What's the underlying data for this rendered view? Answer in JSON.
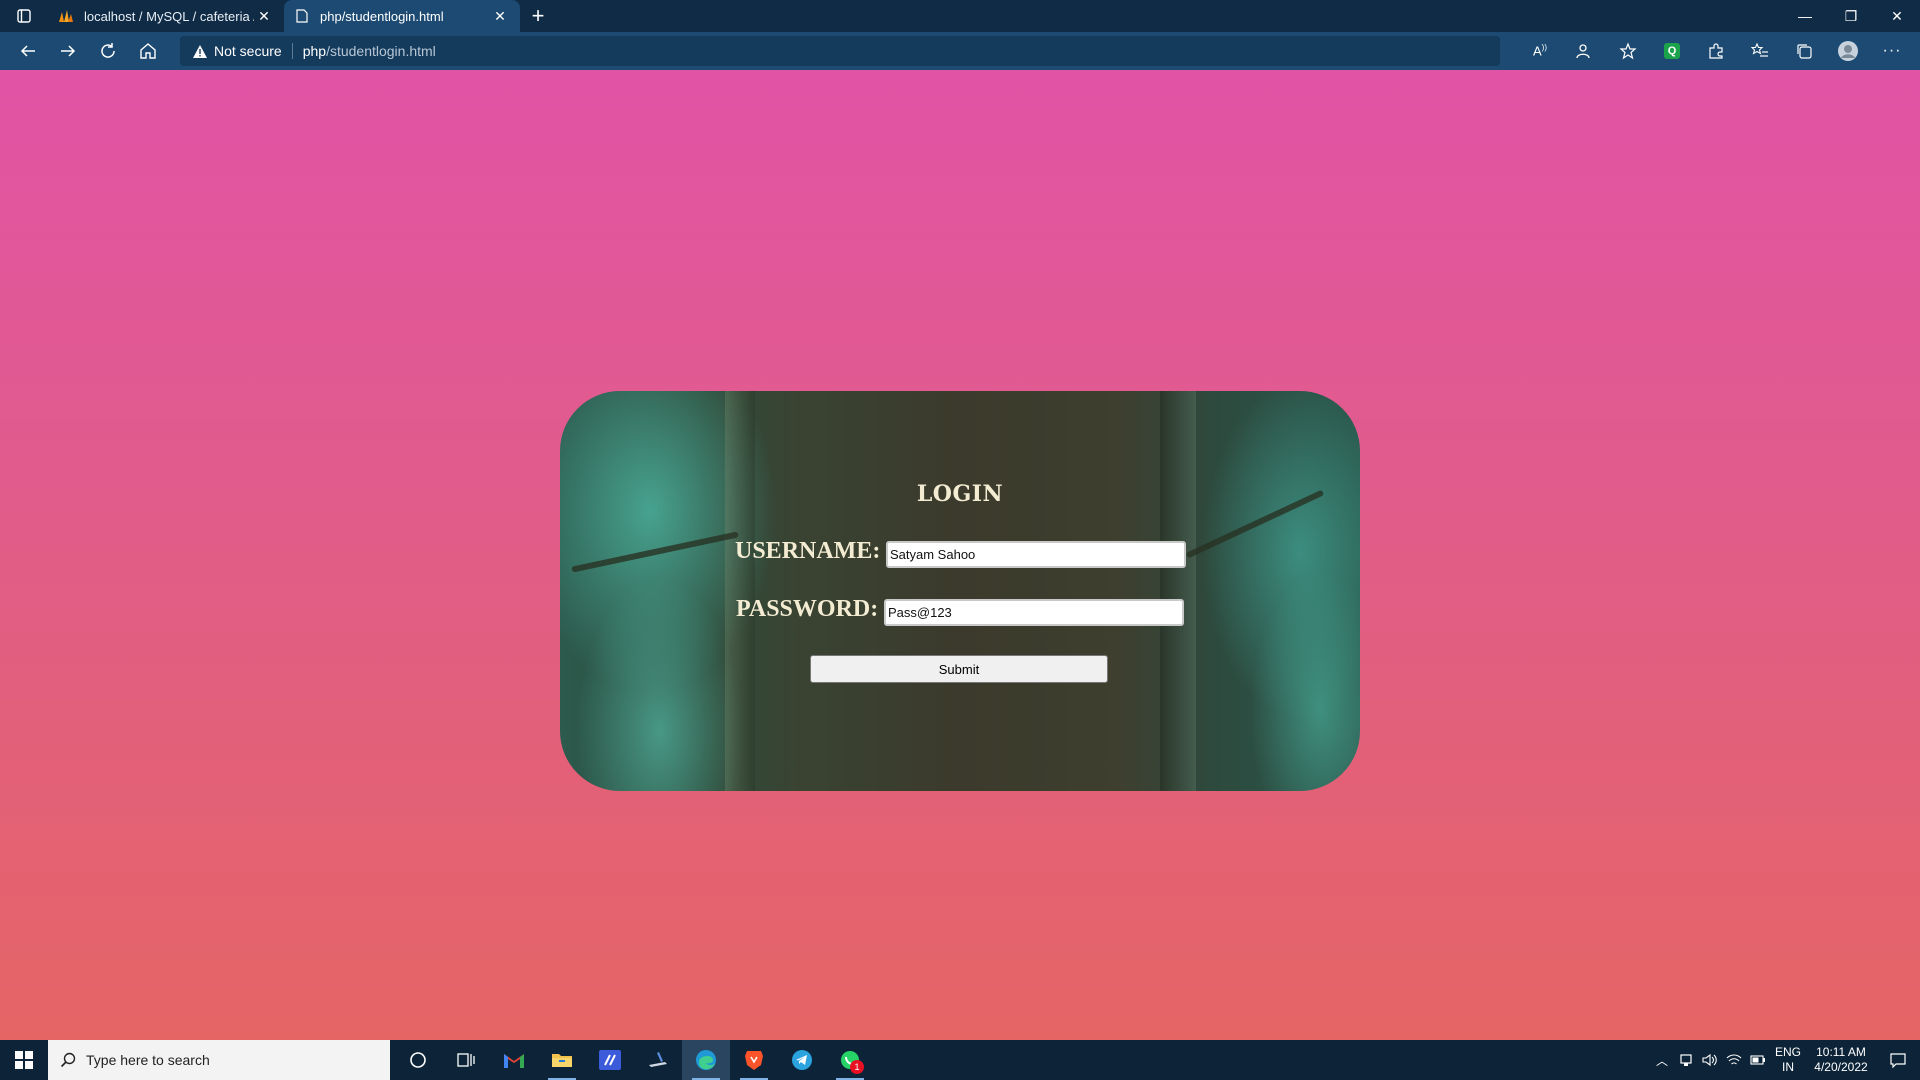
{
  "browser": {
    "tabs": [
      {
        "title": "localhost / MySQL / cafeteria / r",
        "active": false
      },
      {
        "title": "php/studentlogin.html",
        "active": true
      }
    ],
    "security_label": "Not secure",
    "url_host": "php",
    "url_path": "/studentlogin.html"
  },
  "login": {
    "title": "LOGIN",
    "username_label": "USERNAME:",
    "username_value": "Satyam Sahoo",
    "password_label": "PASSWORD:",
    "password_value": "Pass@123",
    "submit_label": "Submit"
  },
  "taskbar": {
    "search_placeholder": "Type here to search",
    "lang_line1": "ENG",
    "lang_line2": "IN",
    "time": "10:11 AM",
    "date": "4/20/2022",
    "whatsapp_badge": "1"
  },
  "colors": {
    "page_gradient_top": "#e153a5",
    "page_gradient_bottom": "#e56565",
    "browser_chrome": "#1c4a72",
    "label_color": "#f3ecd2"
  }
}
